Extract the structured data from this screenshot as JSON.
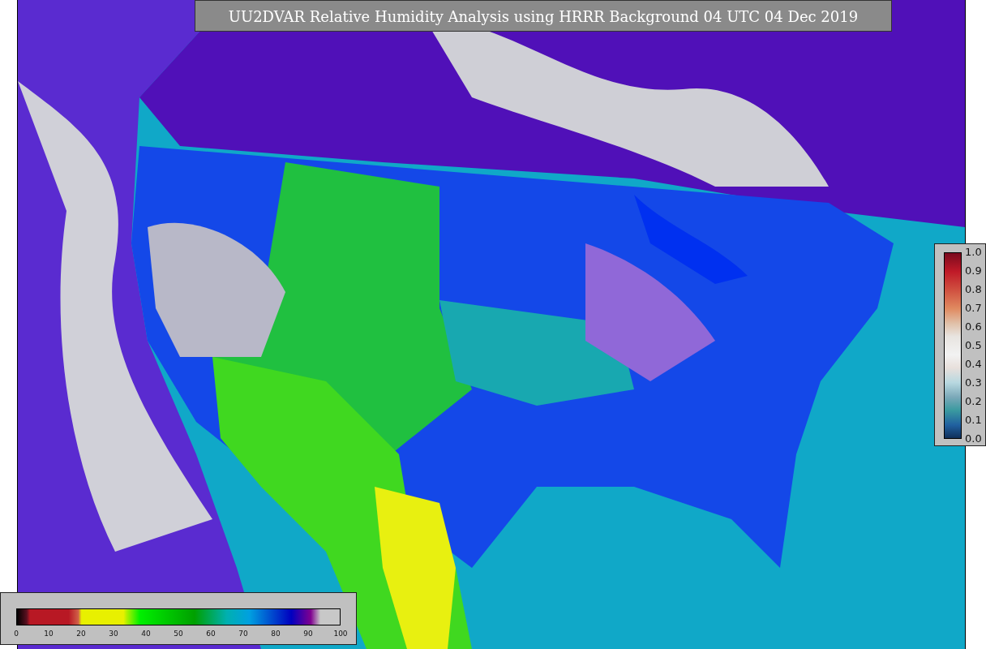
{
  "title": "UU2DVAR Relative Humidity Analysis using HRRR Background 04 UTC 04 Dec 2019",
  "weight_colorbar": {
    "ticks": [
      "1.0",
      "0.9",
      "0.8",
      "0.7",
      "0.6",
      "0.5",
      "0.4",
      "0.3",
      "0.2",
      "0.1",
      "0.0"
    ]
  },
  "humidity_colorbar": {
    "ticks": [
      "0",
      "10",
      "20",
      "30",
      "40",
      "50",
      "60",
      "70",
      "80",
      "90",
      "100"
    ]
  }
}
